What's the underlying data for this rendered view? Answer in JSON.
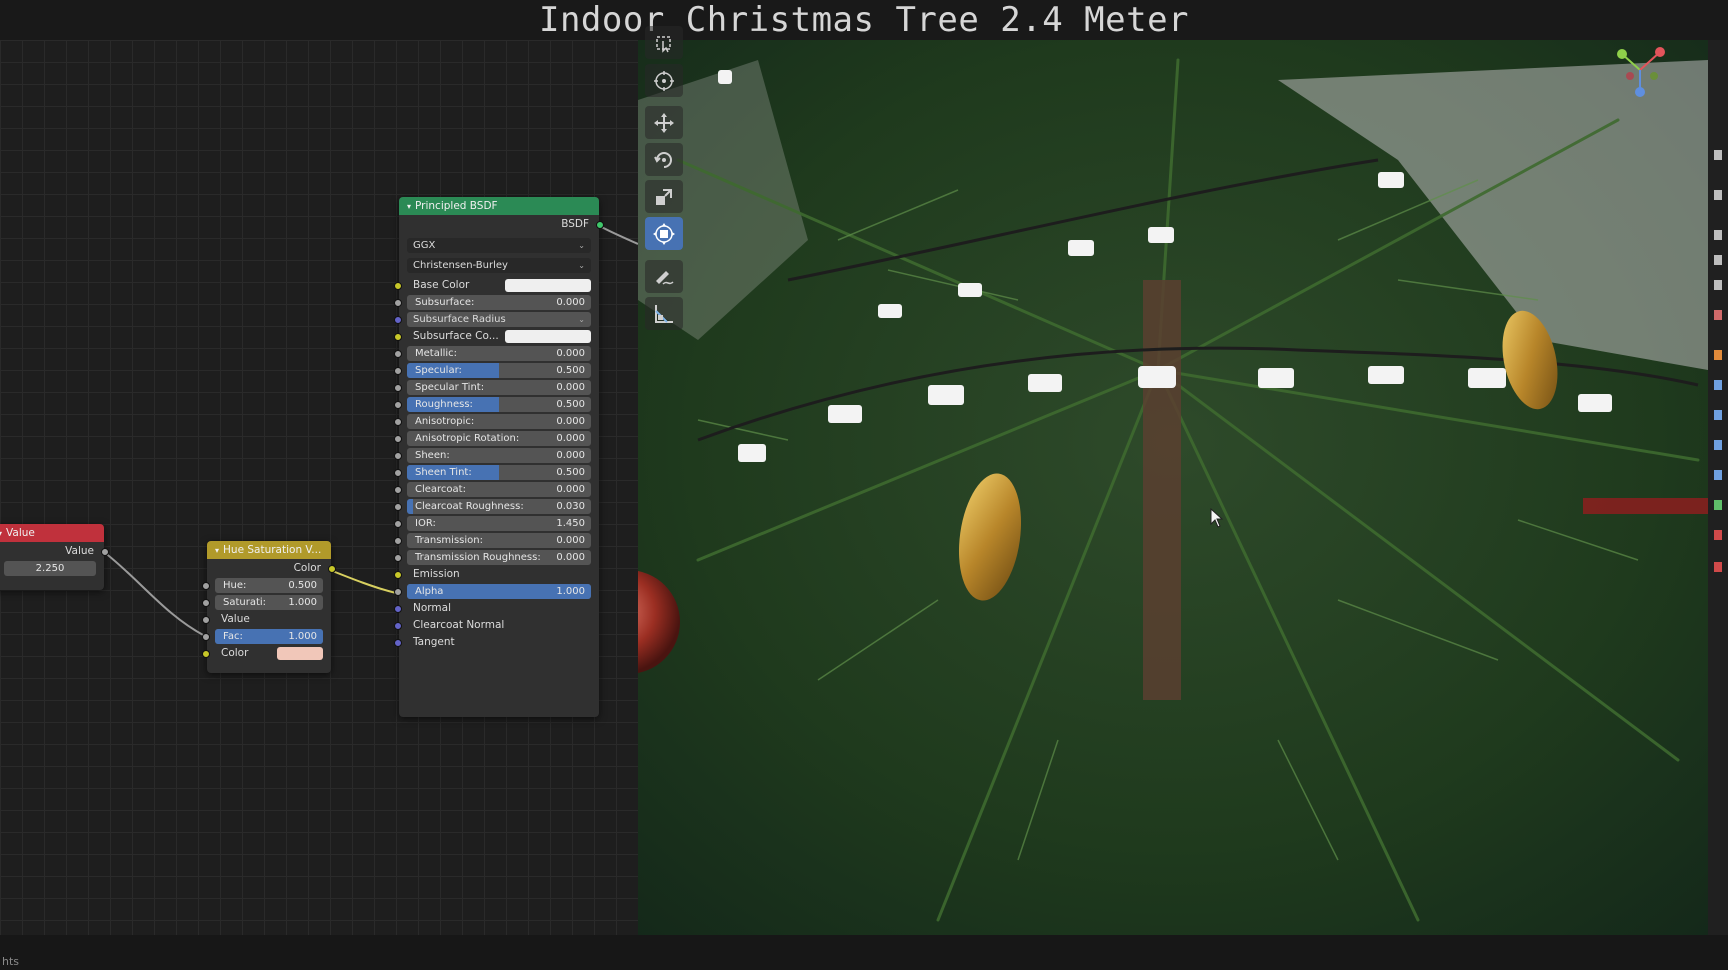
{
  "title": "Indoor Christmas Tree 2.4 Meter",
  "status_bar_text": "hts",
  "colors": {
    "accent": "#4772b3",
    "principled_header": "#2b8a55",
    "value_header": "#c0313c",
    "hue_sat_header": "#b19a2a"
  },
  "nodes": {
    "value": {
      "header": "Value",
      "output": "Value",
      "amount": "2.250"
    },
    "hue_sat": {
      "header": "Hue Saturation V...",
      "output": "Color",
      "hue_label": "Hue:",
      "hue_value": "0.500",
      "sat_label": "Saturati:",
      "sat_value": "1.000",
      "value_label": "Value",
      "fac_label": "Fac:",
      "fac_value": "1.000",
      "color_label": "Color",
      "color_swatch": "#f1c7b9"
    },
    "principled": {
      "header": "Principled BSDF",
      "output": "BSDF",
      "distribution": "GGX",
      "subsurface_method": "Christensen-Burley",
      "base_color_label": "Base Color",
      "subsurface_label": "Subsurface:",
      "subsurface_value": "0.000",
      "subsurface_radius_label": "Subsurface Radius",
      "subsurface_color_label": "Subsurface Co...",
      "metallic_label": "Metallic:",
      "metallic_value": "0.000",
      "specular_label": "Specular:",
      "specular_value": "0.500",
      "specular_fill": 0.5,
      "specular_tint_label": "Specular Tint:",
      "specular_tint_value": "0.000",
      "roughness_label": "Roughness:",
      "roughness_value": "0.500",
      "roughness_fill": 0.5,
      "anisotropic_label": "Anisotropic:",
      "anisotropic_value": "0.000",
      "anisotropic_rotation_label": "Anisotropic Rotation:",
      "anisotropic_rotation_value": "0.000",
      "sheen_label": "Sheen:",
      "sheen_value": "0.000",
      "sheen_tint_label": "Sheen Tint:",
      "sheen_tint_value": "0.500",
      "sheen_tint_fill": 0.5,
      "clearcoat_label": "Clearcoat:",
      "clearcoat_value": "0.000",
      "clearcoat_roughness_label": "Clearcoat Roughness:",
      "clearcoat_roughness_value": "0.030",
      "clearcoat_roughness_fill": 0.03,
      "ior_label": "IOR:",
      "ior_value": "1.450",
      "transmission_label": "Transmission:",
      "transmission_value": "0.000",
      "transmission_roughness_label": "Transmission Roughness:",
      "transmission_roughness_value": "0.000",
      "emission_label": "Emission",
      "alpha_label": "Alpha",
      "alpha_value": "1.000",
      "alpha_fill": 1.0,
      "normal_label": "Normal",
      "clearcoat_normal_label": "Clearcoat Normal",
      "tangent_label": "Tangent"
    }
  },
  "toolbar": [
    {
      "icon": "select-box-icon"
    },
    {
      "icon": "cursor-icon"
    },
    {
      "icon": "move-icon"
    },
    {
      "icon": "rotate-icon"
    },
    {
      "icon": "scale-icon"
    },
    {
      "icon": "transform-icon",
      "active": true
    },
    {
      "icon": "annotate-icon"
    },
    {
      "icon": "measure-icon"
    }
  ]
}
